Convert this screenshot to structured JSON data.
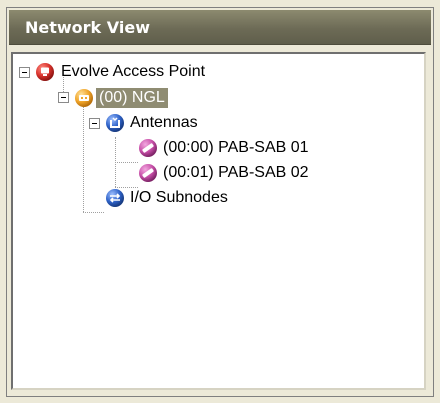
{
  "panel": {
    "title": "Network View"
  },
  "tree": {
    "root": {
      "label": "Evolve Access Point",
      "icon": "access-point-icon",
      "icon_color": "#d8322c",
      "expanded": true
    },
    "ngl": {
      "label": "(00) NGL",
      "icon": "ngl-module-icon",
      "icon_color": "#f0a52a",
      "expanded": true,
      "selected": true
    },
    "antennas": {
      "label": "Antennas",
      "icon": "antennas-folder-icon",
      "icon_color": "#2f63c9",
      "expanded": true
    },
    "antenna_items": [
      {
        "label": "(00:00) PAB-SAB 01",
        "icon": "antenna-icon",
        "icon_color": "#c74fa8"
      },
      {
        "label": "(00:01) PAB-SAB 02",
        "icon": "antenna-icon",
        "icon_color": "#c74fa8"
      }
    ],
    "io_subnodes": {
      "label": "I/O Subnodes",
      "icon": "io-subnodes-icon",
      "icon_color": "#2f63c9"
    }
  },
  "colors": {
    "selection_bg": "#8f8c72",
    "titlebar": "#6d6b56"
  }
}
